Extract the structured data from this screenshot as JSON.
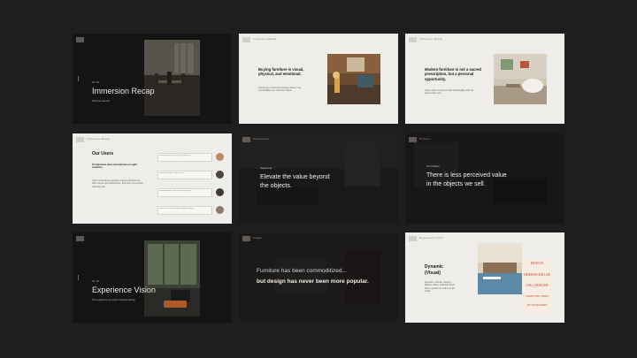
{
  "slides": [
    {
      "id": 1,
      "theme": "dark",
      "brand": "",
      "label": "01 / 06",
      "title": "Immersion Recap",
      "subtitle": "What we learned"
    },
    {
      "id": 2,
      "theme": "light",
      "brand": "Immersion Recap",
      "title": "Buying furniture is visual, physical, and emotional.",
      "body": "Users rely on how the furniture looks, how comfortable it is, and how it feels."
    },
    {
      "id": 3,
      "theme": "light",
      "brand": "Immersion Recap",
      "title": "Modern furniture is not a sacred prescription, but a personal opportunity.",
      "body": "Users want to express their individuality with the pieces they own."
    },
    {
      "id": 4,
      "theme": "light",
      "brand": "Immersion Recap",
      "title": "Our Users",
      "bold": "67 interviews were recorded across eight countries.",
      "body": "Users of furniture purchase various furniture for their homes and workplaces, and use it to express who they are."
    },
    {
      "id": 5,
      "theme": "dark",
      "brand": "Opportunity",
      "label": "Opportunity",
      "title_line1": "Elevate the value beyond",
      "title_line2": "the objects."
    },
    {
      "id": 6,
      "theme": "dark",
      "brand": "Problem",
      "label": "The Problem",
      "title_line1": "There is less perceived value",
      "title_line2": "in the objects we sell."
    },
    {
      "id": 7,
      "theme": "dark",
      "brand": "",
      "label": "02 / 06",
      "title": "Experience Vision",
      "subtitle": "The experience of modern furniture design"
    },
    {
      "id": 8,
      "theme": "dark",
      "brand": "Insight",
      "line1": "Furniture has been commoditized...",
      "line2": "but design has never been more popular."
    },
    {
      "id": 9,
      "theme": "light",
      "brand": "Experience Vision",
      "title_line1": "Dynamic",
      "title_line2": "(Visual)",
      "body": "Dynamic. Human. Great in Motion. Warm. Editorial. More than a product to sell it is part of life.",
      "poster_lines": [
        "DESIGN",
        "HERMAN MILLER",
        "LOLL DESIGNS",
        "WRITE THE STORY",
        "OF YOUR HOME"
      ]
    }
  ],
  "user_quotes": [
    {
      "name": "User A",
      "quote": "I love furniture that has a story behind it."
    },
    {
      "name": "User B",
      "quote": "I want my home to feel like me."
    },
    {
      "name": "User C",
      "quote": "Comfort matters more than the price tag."
    },
    {
      "name": "User D",
      "quote": "I like to see and touch pieces before buying."
    }
  ],
  "colors": {
    "canvas": "#201d1e",
    "dark_slide": "#151414",
    "light_slide": "#eeedea",
    "accent_red": "#c34a2c"
  }
}
